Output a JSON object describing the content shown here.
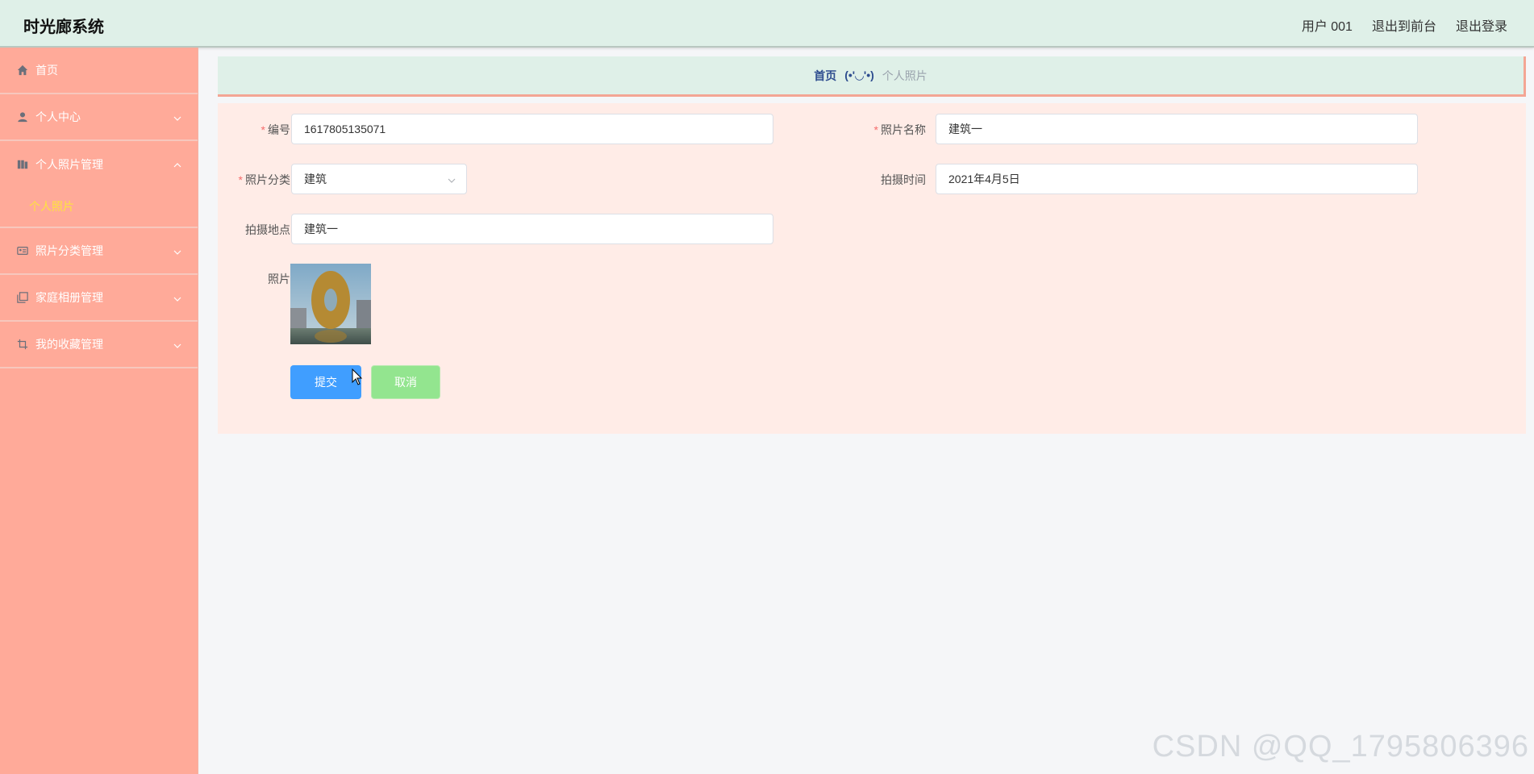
{
  "app": {
    "title": "时光廊系统",
    "nav": [
      "用户 001",
      "退出到前台",
      "退出登录"
    ]
  },
  "sidebar": {
    "items": [
      {
        "label": "首页",
        "icon": "home-icon"
      },
      {
        "label": "个人中心",
        "icon": "user-icon"
      },
      {
        "label": "个人照片管理",
        "icon": "book-icon"
      },
      {
        "label": "照片分类管理",
        "icon": "id-card-icon"
      },
      {
        "label": "家庭相册管理",
        "icon": "copy-icon"
      },
      {
        "label": "我的收藏管理",
        "icon": "crop-icon"
      }
    ],
    "submenu": "个人照片"
  },
  "breadcrumb": {
    "home": "首页",
    "separator": "(•'◡'•)",
    "current": "个人照片"
  },
  "form": {
    "id_label": "编号",
    "id_value": "1617805135071",
    "name_label": "照片名称",
    "name_value": "建筑一",
    "category_label": "照片分类",
    "category_value": "建筑",
    "time_label": "拍摄时间",
    "time_value": "2021年4月5日",
    "location_label": "拍摄地点",
    "location_value": "建筑一",
    "photo_label": "照片",
    "required_mark": "*",
    "submit_label": "提交",
    "cancel_label": "取消"
  },
  "colors": {
    "header_bg": "#dff0e8",
    "sidebar_bg": "#ffaa99",
    "panel_bg": "#ffece7",
    "submit_bg": "#409eff",
    "cancel_bg": "#93e58f",
    "active_submenu": "#ffe23f"
  },
  "watermark": "CSDN @QQ_1795806396"
}
